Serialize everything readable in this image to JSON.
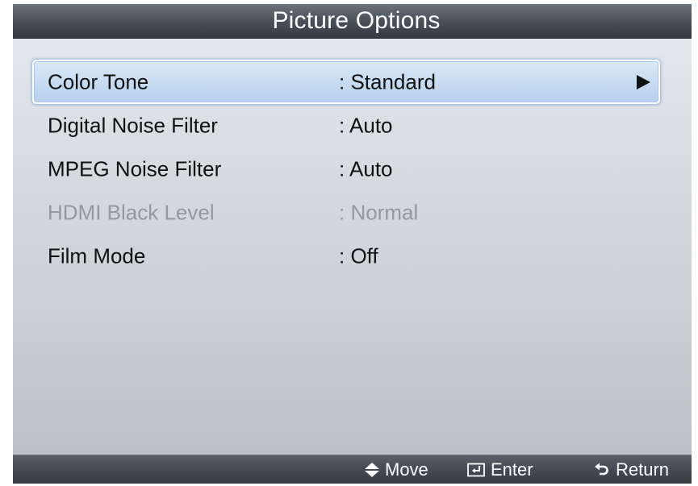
{
  "title": "Picture Options",
  "menu": {
    "items": [
      {
        "label": "Color Tone",
        "value": ": Standard",
        "selected": true,
        "enabled": true,
        "has_submenu": true
      },
      {
        "label": "Digital Noise Filter",
        "value": ": Auto",
        "selected": false,
        "enabled": true
      },
      {
        "label": "MPEG Noise Filter",
        "value": ": Auto",
        "selected": false,
        "enabled": true
      },
      {
        "label": "HDMI Black Level",
        "value": ": Normal",
        "selected": false,
        "enabled": false
      },
      {
        "label": "Film Mode",
        "value": ": Off",
        "selected": false,
        "enabled": true
      }
    ]
  },
  "footer": {
    "move_label": "Move",
    "move_icon": "up-down-icon",
    "enter_label": "Enter",
    "enter_icon": "enter-icon",
    "return_label": "Return",
    "return_icon": "return-icon"
  },
  "colors": {
    "selection": "#c7dcf2",
    "title_bar": "#4d535b",
    "disabled_text": "#9399a0"
  }
}
